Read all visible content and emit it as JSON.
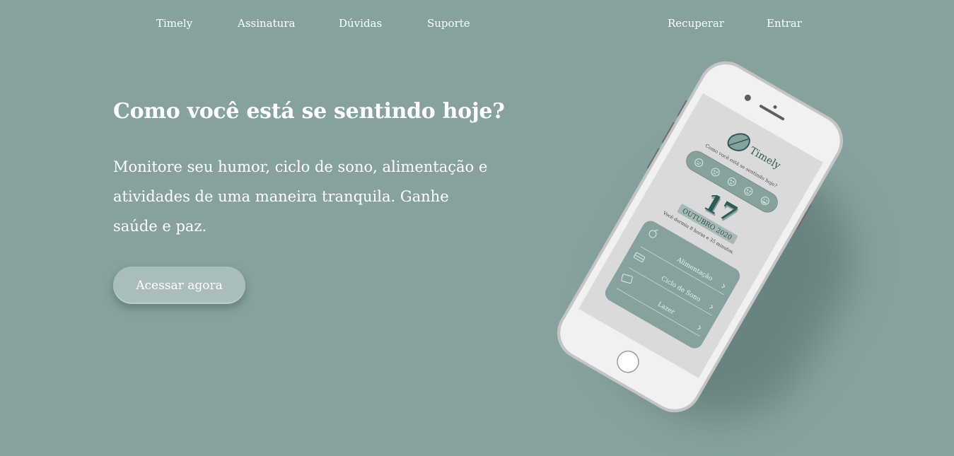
{
  "nav": {
    "brand": "Timely",
    "items": [
      "Assinatura",
      "Dúvidas",
      "Suporte"
    ],
    "recover": "Recuperar",
    "login": "Entrar"
  },
  "hero": {
    "title": "Como você está se sentindo hoje?",
    "description": "Monitore seu humor, ciclo de sono, alimentação e atividades de uma maneira tranquila. Ganhe saúde e paz.",
    "cta": "Acessar agora"
  },
  "phone": {
    "app_name": "Timely",
    "question": "Como você está se sentindo hoje?",
    "mood_icons": [
      "mood-angry-icon",
      "mood-sad-icon",
      "mood-neutral-icon",
      "mood-happy-icon",
      "mood-very-happy-icon"
    ],
    "day": "17",
    "month_year": "OUTUBRO 2020",
    "sleep_message": "Você dormiu 8 horas e 35 minutos.",
    "menu": [
      {
        "label": "Alimentação",
        "icon": "apple-icon"
      },
      {
        "label": "Ciclo de Sono",
        "icon": "bed-icon"
      },
      {
        "label": "Lazer",
        "icon": "ticket-icon"
      }
    ],
    "colors": {
      "background": "#87a29e",
      "accent": "#87a29e",
      "accent_dark": "#2f5a55",
      "screen": "#dadada",
      "body": "#f2f2f2"
    }
  }
}
